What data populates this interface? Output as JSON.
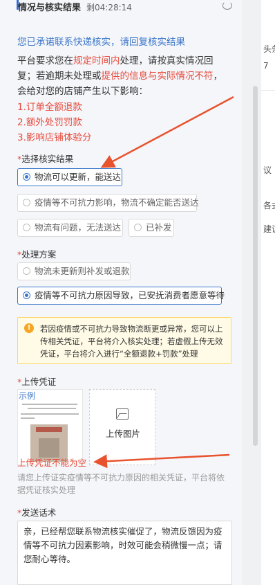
{
  "header": {
    "title": "情况与核实结果",
    "countdown": "剩04:28:14"
  },
  "background_page": {
    "items": [
      "头条",
      "7",
      "议",
      "各式",
      "建议"
    ]
  },
  "intro": {
    "promise": "您已承诺联系快递核实，请回复核实结果",
    "line1_a": "平台要求您在",
    "line1_red": "规定时间内",
    "line1_b": "处理，请按真实情况回",
    "line2_a": "复；若逾期未处理或",
    "line2_red": "提供的信息与实际情况不符",
    "line2_b": "，",
    "line3": "会给对您的店铺产生以下影响：",
    "impacts": [
      "1.订单全额退款",
      "2.额外处罚罚款",
      "3.影响店铺体验分"
    ]
  },
  "verify": {
    "label": "选择核实结果",
    "options": [
      {
        "text": "物流可以更新，能送达",
        "selected": true
      },
      {
        "text": "疫情等不可抗力影响，物流不确定能否送达",
        "selected": false
      },
      {
        "text": "物流有问题，无法送达",
        "selected": false
      },
      {
        "text": "已补发",
        "selected": false
      }
    ]
  },
  "plan": {
    "label": "处理方案",
    "options": [
      {
        "text": "物流未更新则补发或退款",
        "selected": false
      },
      {
        "text": "疫情等不可抗力原因导致，已安抚消费者愿意等待",
        "selected": true
      }
    ]
  },
  "notice": {
    "text": "若因疫情或不可抗力导致物流断更或异常，您可以上传相关凭证，平台将介入核实处理；若虚假上传无效凭证，平台将介入进行“全额退款+罚款”处理"
  },
  "upload": {
    "label": "上传凭证",
    "example_label": "示例",
    "button_label": "上传图片",
    "error": "上传凭证不能为空",
    "help": "请您上传证实疫情等不可抗力原因的相关凭证，平台将依据凭证核实处理"
  },
  "speech": {
    "label": "发送话术",
    "value": "亲，已经帮您联系物流核实催促了，物流反馈因为疫情等不可抗力因素影响，时效可能会稍微慢一点；请您耐心等待。"
  },
  "colors": {
    "accent": "#3a76c9",
    "danger": "#e64b3c",
    "arrow": "#e8532e"
  }
}
